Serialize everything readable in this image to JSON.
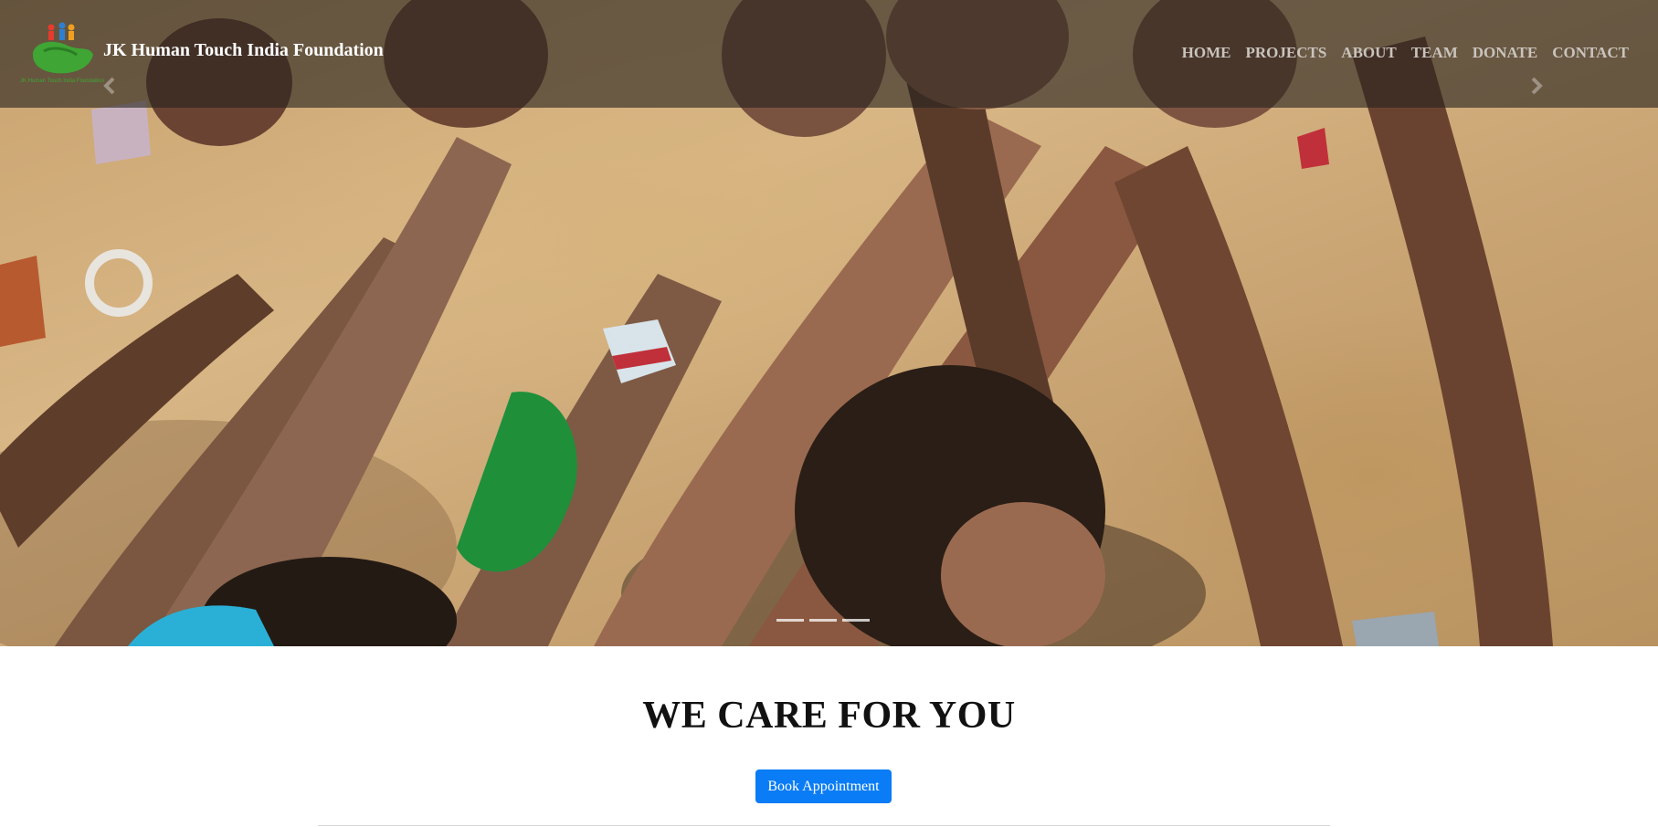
{
  "brand": {
    "name": "JK Human Touch India Foundation",
    "logo_caption": "JK Human Touch India Foundation",
    "logo_icon": "hand-people-logo"
  },
  "nav": {
    "items": [
      {
        "label": "HOME"
      },
      {
        "label": "PROJECTS"
      },
      {
        "label": "ABOUT"
      },
      {
        "label": "TEAM"
      },
      {
        "label": "DONATE"
      },
      {
        "label": "CONTACT"
      }
    ]
  },
  "carousel": {
    "slide_count": 3,
    "active_index": 0,
    "prev_icon": "chevron-left-icon",
    "next_icon": "chevron-right-icon"
  },
  "main": {
    "heading": "WE CARE FOR YOU",
    "cta_label": "Book Appointment"
  },
  "colors": {
    "primary_button": "#0a7cf5",
    "navbar_overlay": "rgba(40,36,30,0.62)",
    "logo_green": "#3fa535"
  }
}
